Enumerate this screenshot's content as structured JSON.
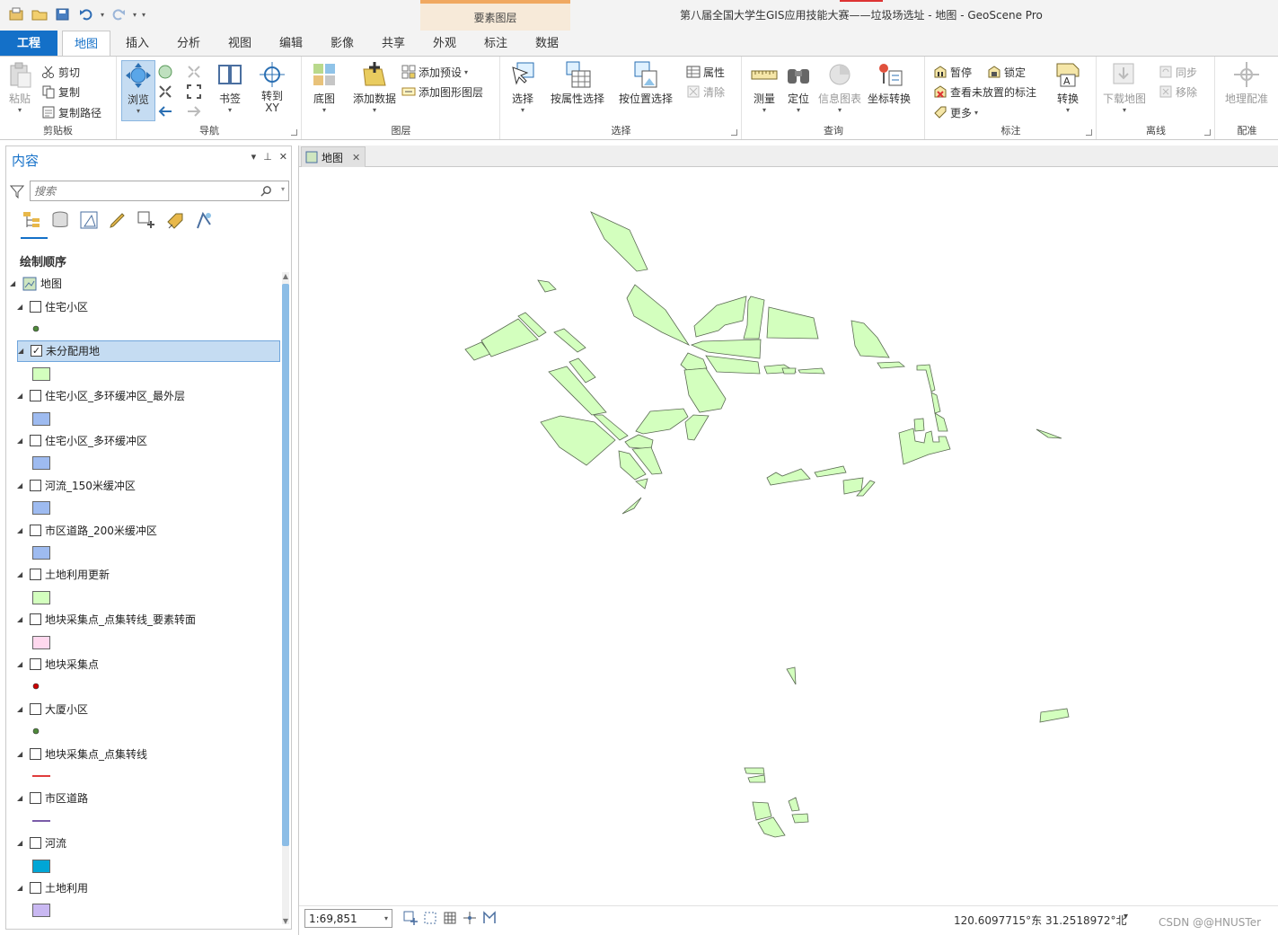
{
  "window": {
    "title": "第八届全国大学生GIS应用技能大赛——垃圾场选址 - 地图 - GeoScene Pro",
    "context_group": "要素图层"
  },
  "tabs": [
    {
      "label": "工程"
    },
    {
      "label": "地图"
    },
    {
      "label": "插入"
    },
    {
      "label": "分析"
    },
    {
      "label": "视图"
    },
    {
      "label": "编辑"
    },
    {
      "label": "影像"
    },
    {
      "label": "共享"
    },
    {
      "label": "外观"
    },
    {
      "label": "标注"
    },
    {
      "label": "数据"
    }
  ],
  "ribbon": {
    "clipboard": {
      "label": "剪贴板",
      "paste": "粘贴",
      "cut": "剪切",
      "copy": "复制",
      "copy_path": "复制路径"
    },
    "navigate": {
      "label": "导航",
      "explore": "浏览",
      "bookmarks": "书签",
      "goto_xy": "转到\nXY"
    },
    "layer": {
      "label": "图层",
      "basemap": "底图",
      "add_data": "添加数据",
      "add_preset": "添加预设",
      "add_graphics": "添加图形图层"
    },
    "selection": {
      "label": "选择",
      "select": "选择",
      "select_by_attr": "按属性选择",
      "select_by_loc": "按位置选择",
      "attributes": "属性",
      "clear": "清除"
    },
    "inquiry": {
      "label": "查询",
      "measure": "测量",
      "locate": "定位",
      "infographics": "信息图表",
      "coord_convert": "坐标转换"
    },
    "labeling": {
      "label": "标注",
      "pause": "暂停",
      "lock": "锁定",
      "view_unplaced": "查看未放置的标注",
      "more": "更多",
      "convert": "转换"
    },
    "offline": {
      "label": "离线",
      "download_map": "下载地图",
      "sync": "同步",
      "remove": "移除"
    },
    "georef": {
      "label": "配准",
      "georeference": "地理配准"
    }
  },
  "contents": {
    "title": "内容",
    "search_placeholder": "搜索",
    "draw_order": "绘制顺序",
    "map_node": "地图",
    "layers": [
      {
        "name": "住宅小区",
        "checked": false,
        "symbol": "point",
        "color": "#4f8a3a"
      },
      {
        "name": "未分配用地",
        "checked": true,
        "symbol": "fill",
        "color": "#d3ffbe",
        "selected": true
      },
      {
        "name": "住宅小区_多环缓冲区_最外层",
        "checked": false,
        "symbol": "fill",
        "color": "#9ebbf0"
      },
      {
        "name": "住宅小区_多环缓冲区",
        "checked": false,
        "symbol": "fill",
        "color": "#9ebbf0"
      },
      {
        "name": "河流_150米缓冲区",
        "checked": false,
        "symbol": "fill",
        "color": "#9ebbf0"
      },
      {
        "name": "市区道路_200米缓冲区",
        "checked": false,
        "symbol": "fill",
        "color": "#9ebbf0"
      },
      {
        "name": "土地利用更新",
        "checked": false,
        "symbol": "fill",
        "color": "#d3ffbe"
      },
      {
        "name": "地块采集点_点集转线_要素转面",
        "checked": false,
        "symbol": "fill",
        "color": "#ffd8ee"
      },
      {
        "name": "地块采集点",
        "checked": false,
        "symbol": "point",
        "color": "#cc0000"
      },
      {
        "name": "大厦小区",
        "checked": false,
        "symbol": "point",
        "color": "#4f8a3a"
      },
      {
        "name": "地块采集点_点集转线",
        "checked": false,
        "symbol": "line",
        "color": "#e03c3c"
      },
      {
        "name": "市区道路",
        "checked": false,
        "symbol": "line",
        "color": "#7a5ca8"
      },
      {
        "name": "河流",
        "checked": false,
        "symbol": "fill",
        "color": "#00a6d6"
      },
      {
        "name": "土地利用",
        "checked": false,
        "symbol": "fill",
        "color": "#c9b8f2"
      }
    ]
  },
  "map_view": {
    "tab_label": "地图",
    "scale": "1:69,851",
    "coordinates": "120.6097715°东 31.2518972°北",
    "watermark": "CSDN @@HNUSTer",
    "polygon_fill": "#d3ffbe",
    "polygon_stroke": "#5a6a52"
  }
}
